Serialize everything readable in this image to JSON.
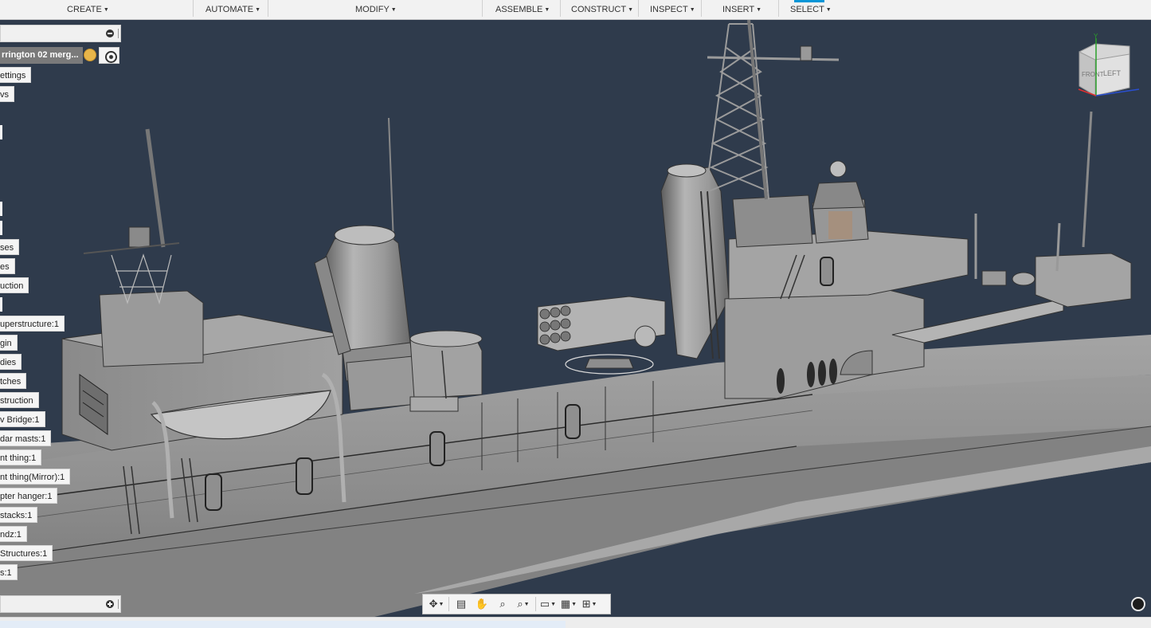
{
  "toolbar": {
    "create": "CREATE",
    "automate": "AUTOMATE",
    "modify": "MODIFY",
    "assemble": "ASSEMBLE",
    "construct": "CONSTRUCT",
    "inspect": "INSPECT",
    "insert": "INSERT",
    "select": "SELECT"
  },
  "browser": {
    "document_name": "rrington 02 merg...",
    "items": [
      "ettings",
      "vs",
      "ses",
      "es",
      "uction",
      "uperstructure:1",
      "gin",
      "dies",
      "tches",
      "struction",
      "v Bridge:1",
      "dar masts:1",
      "nt thing:1",
      "nt thing(Mirror):1",
      "pter hanger:1",
      "stacks:1",
      "ndz:1",
      "Structures:1",
      "s:1"
    ]
  },
  "viewcube": {
    "front_label": "FRONT",
    "left_label": "LEFT",
    "axis_x_color": "#e03030",
    "axis_y_color": "#2aa02a",
    "axis_z_color": "#2a4fd0"
  },
  "navbar": {
    "icons": [
      "orbit-icon",
      "look-at-icon",
      "pan-icon",
      "zoom-icon",
      "fit-icon",
      "display-settings-icon",
      "grid-icon",
      "viewports-icon"
    ]
  },
  "colors": {
    "viewport_bg": "#2f3b4c",
    "hull": "#8a8a8a",
    "accent": "#0696d7"
  }
}
